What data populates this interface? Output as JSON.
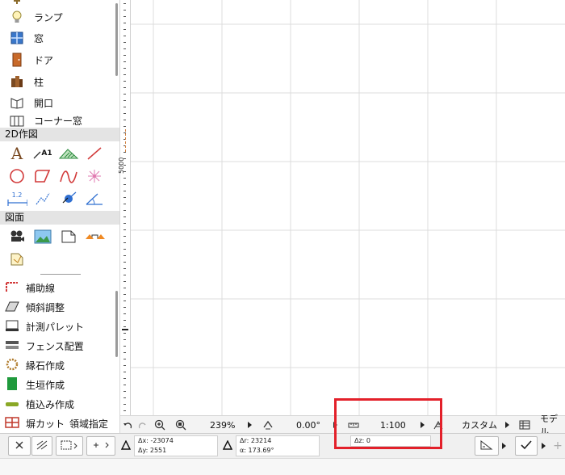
{
  "toolbox": {
    "top_items": [
      {
        "label": "ランプ",
        "icon": "lamp-icon"
      },
      {
        "label": "窓",
        "icon": "window-icon"
      },
      {
        "label": "ドア",
        "icon": "door-icon"
      },
      {
        "label": "柱",
        "icon": "column-icon"
      },
      {
        "label": "開口",
        "icon": "opening-icon"
      },
      {
        "label": "コーナー窓",
        "icon": "corner-window-icon"
      }
    ],
    "section_2d": "2D作図",
    "section_drawing": "図面",
    "text_tool_glyph": "A",
    "label_tool_glyph": "A1",
    "dimension_glyph": "1.2",
    "level_glyph": "1.2",
    "lower_items": [
      {
        "label": "補助線",
        "icon": "guide-line-icon"
      },
      {
        "label": "傾斜調整",
        "icon": "slope-adjust-icon"
      },
      {
        "label": "計測パレット",
        "icon": "measure-palette-icon"
      },
      {
        "label": "フェンス配置",
        "icon": "fence-icon"
      },
      {
        "label": "縁石作成",
        "icon": "curb-icon"
      },
      {
        "label": "生垣作成",
        "icon": "hedge-icon"
      },
      {
        "label": "植込み作成",
        "icon": "planting-icon"
      },
      {
        "label": "塀カット",
        "icon": "wall-cut-icon"
      }
    ],
    "region_label": "領域指定"
  },
  "ruler": {
    "label": "5000"
  },
  "statusbar": {
    "zoom": "239%",
    "rotation": "0.00°",
    "scale": "1:100",
    "structure_display": "カスタム",
    "model_view": "モデル"
  },
  "coordinates": {
    "dx": "Δx: -23074",
    "dy": "Δy: 2551",
    "dr": "Δr: 23214",
    "angle": "α: 173.69°",
    "dz": "Δz: 0"
  },
  "colors": {
    "highlight": "#e3202a",
    "grid": "#dcdcdc",
    "accent_orange": "#f08a24",
    "green": "#1f9a3c",
    "blue": "#2f6fd1"
  }
}
